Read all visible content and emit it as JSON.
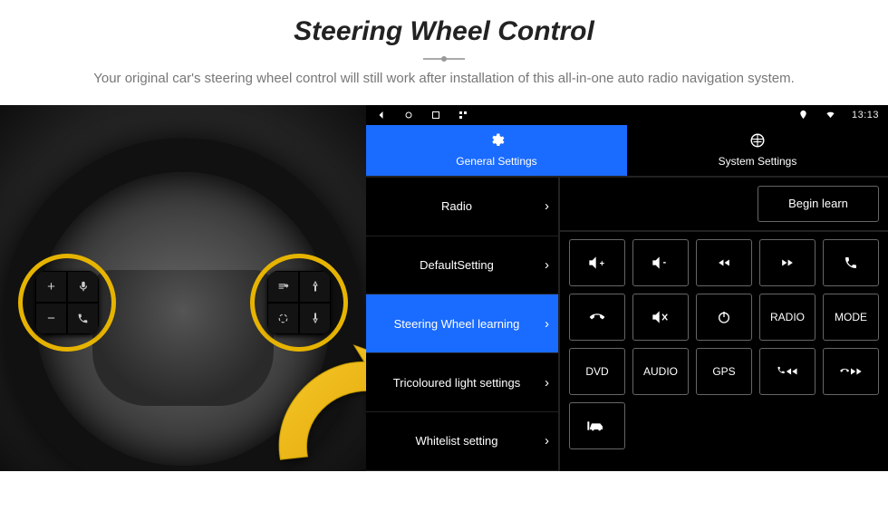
{
  "hero": {
    "title": "Steering Wheel Control",
    "subtitle": "Your original car's steering wheel control will still work after installation of this all-in-one auto radio navigation system."
  },
  "steering": {
    "left_cluster": [
      "+",
      "voice",
      "−",
      "phone"
    ],
    "right_cluster": [
      "src",
      "up",
      "cycle",
      "down"
    ]
  },
  "status_bar": {
    "clock": "13:13"
  },
  "tabs": {
    "general": "General Settings",
    "system": "System Settings"
  },
  "menu": [
    {
      "label": "Radio",
      "active": false
    },
    {
      "label": "DefaultSetting",
      "active": false
    },
    {
      "label": "Steering Wheel learning",
      "active": true
    },
    {
      "label": "Tricoloured light settings",
      "active": false
    },
    {
      "label": "Whitelist setting",
      "active": false
    }
  ],
  "actions": {
    "begin_learn": "Begin learn"
  },
  "keys": {
    "row1": [
      "vol-up",
      "vol-down",
      "prev",
      "next",
      "call"
    ],
    "row2": [
      "hangup",
      "mute",
      "power",
      "RADIO",
      "MODE"
    ],
    "row3": [
      "DVD",
      "AUDIO",
      "GPS",
      "call-prev",
      "call-next"
    ],
    "row4": [
      "car"
    ]
  }
}
